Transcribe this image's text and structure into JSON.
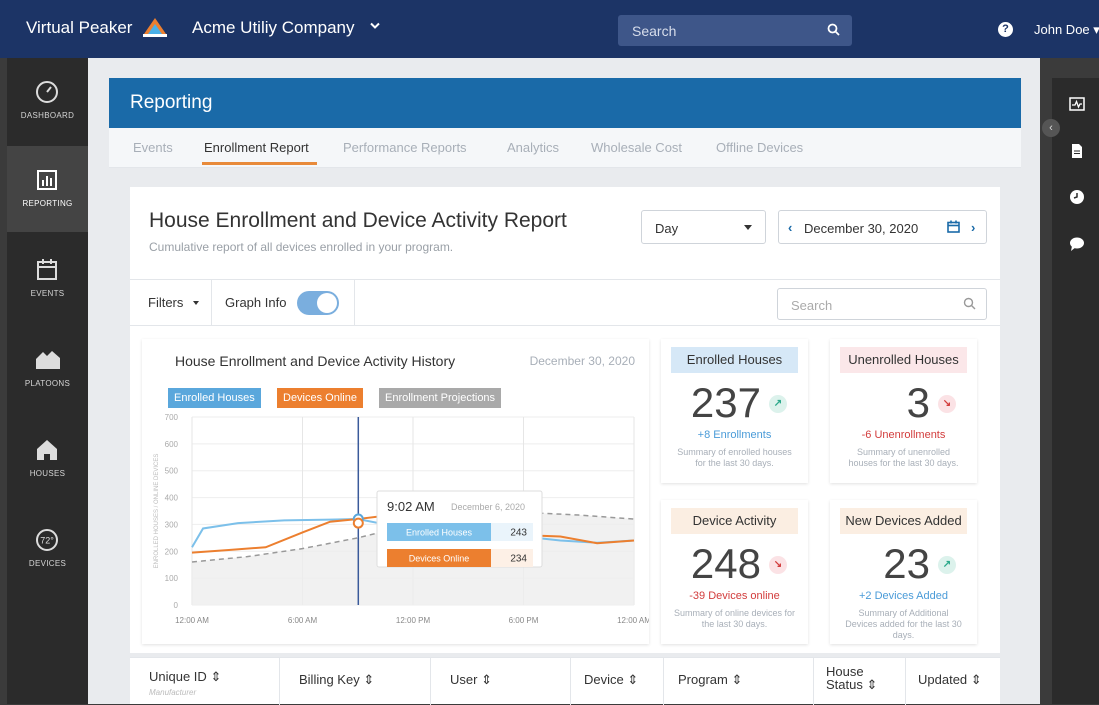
{
  "topbar": {
    "brand": "Virtual Peaker",
    "org": "Acme Utiliy Company",
    "search_placeholder": "Search",
    "user": "John Doe"
  },
  "leftnav": [
    {
      "label": "DASHBOARD",
      "icon": "gauge-icon",
      "active": false
    },
    {
      "label": "REPORTING",
      "icon": "bar-chart-icon",
      "active": true
    },
    {
      "label": "EVENTS",
      "icon": "calendar-icon",
      "active": false
    },
    {
      "label": "PLATOONS",
      "icon": "houses-group-icon",
      "active": false
    },
    {
      "label": "HOUSES",
      "icon": "house-icon",
      "active": false
    },
    {
      "label": "DEVICES",
      "icon": "thermostat-icon",
      "active": false
    }
  ],
  "device_badge": "72°",
  "section_title": "Reporting",
  "tabs": [
    "Events",
    "Enrollment Report",
    "Performance Reports",
    "Analytics",
    "Wholesale Cost",
    "Offline Devices"
  ],
  "report": {
    "title": "House Enrollment and Device Activity Report",
    "subtitle": "Cumulative report of all devices enrolled in your program.",
    "period": "Day",
    "date": "December 30, 2020"
  },
  "filterbar": {
    "filters_label": "Filters",
    "graph_info_label": "Graph Info",
    "graph_info_on": true,
    "search_placeholder": "Search"
  },
  "graph": {
    "title": "House Enrollment and Device Activity History",
    "date": "December 30, 2020",
    "legend": [
      {
        "label": "Enrolled Houses",
        "color": "#5aa7dc"
      },
      {
        "label": "Devices Online",
        "color": "#ec7f2f"
      },
      {
        "label": "Enrollment Projections",
        "color": "#a9a9a9"
      }
    ],
    "tooltip": {
      "time": "9:02 AM",
      "date": "December 6, 2020",
      "rows": [
        {
          "label": "Enrolled Houses",
          "value": "243"
        },
        {
          "label": "Devices Online",
          "value": "234"
        }
      ]
    }
  },
  "chart_data": {
    "type": "line",
    "ylabel": "ENROLLED HOUSES / ONLINE DEVICES",
    "ylim": [
      0,
      700
    ],
    "yticks": [
      "700",
      "600",
      "500",
      "400",
      "300",
      "200",
      "100",
      "0"
    ],
    "xticks": [
      "12:00 AM",
      "6:00 AM",
      "12:00 PM",
      "6:00 PM",
      "12:00 AM"
    ],
    "grid": true,
    "series": [
      {
        "name": "Enrolled Houses",
        "color": "#7cc0ea",
        "x": [
          0,
          0.6,
          2.5,
          5,
          7.5,
          9,
          10.5,
          12,
          14,
          16,
          18,
          20,
          22,
          24
        ],
        "values": [
          215,
          285,
          305,
          315,
          318,
          320,
          300,
          285,
          270,
          265,
          255,
          240,
          232,
          240
        ]
      },
      {
        "name": "Devices Online",
        "color": "#ec7f2f",
        "x": [
          0,
          2,
          4,
          6,
          7.5,
          9,
          10.2,
          12,
          14,
          16,
          18,
          20,
          22,
          24
        ],
        "values": [
          195,
          205,
          215,
          270,
          310,
          320,
          330,
          300,
          280,
          270,
          260,
          255,
          230,
          240
        ]
      },
      {
        "name": "Enrollment Projections",
        "color": "#a9a9a9",
        "x": [
          0,
          3,
          6,
          9,
          12,
          15,
          18,
          21,
          24
        ],
        "values": [
          160,
          180,
          210,
          250,
          300,
          340,
          345,
          335,
          320
        ]
      }
    ]
  },
  "stats": [
    {
      "title": "Enrolled Houses",
      "value": "237",
      "delta": "+8 Enrollments",
      "summary": "Summary of enrolled houses for the last 30 days.",
      "trend": "up",
      "head_color": "#d6e8f7",
      "delta_color": "#4a9bd8"
    },
    {
      "title": "Unenrolled Houses",
      "value": "3",
      "delta": "-6 Unenrollments",
      "summary": "Summary of unenrolled houses for the last 30 days.",
      "trend": "down",
      "head_color": "#fbe7e9",
      "delta_color": "#d23c3c"
    },
    {
      "title": "Device Activity",
      "value": "248",
      "delta": "-39 Devices online",
      "summary": "Summary of online devices for the last 30 days.",
      "trend": "down",
      "head_color": "#fbeee2",
      "delta_color": "#d23c3c"
    },
    {
      "title": "New Devices Added",
      "value": "23",
      "delta": "+2 Devices Added",
      "summary": "Summary of Additional Devices added for the last 30 days.",
      "trend": "up",
      "head_color": "#fbeee2",
      "delta_color": "#4a9bd8"
    }
  ],
  "table": {
    "columns": [
      "Unique ID",
      "Billing Key",
      "User",
      "Device",
      "Program",
      "House Status",
      "Updated"
    ],
    "sub": "Manufacturer",
    "sort_glyph": "⇕"
  }
}
